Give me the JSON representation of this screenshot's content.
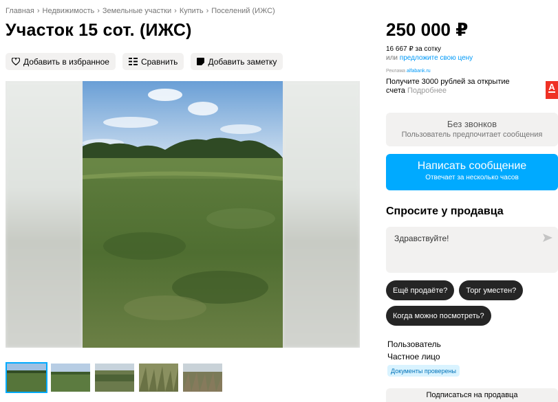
{
  "breadcrumb": [
    "Главная",
    "Недвижимость",
    "Земельные участки",
    "Купить",
    "Поселений (ИЖС)"
  ],
  "breadcrumb_sep": "›",
  "title": "Участок 15 сот. (ИЖС)",
  "actions": {
    "favorite": "Добавить в избранное",
    "compare": "Сравнить",
    "note": "Добавить заметку"
  },
  "gallery": {
    "thumb_count": 5,
    "active_thumb": 1
  },
  "price": "250 000 ₽",
  "price_per_sotka": "16 667 ₽ за сотку",
  "offer_prefix": "или",
  "offer_link": "предложите свою цену",
  "ad": {
    "label": "Реклама",
    "source": "alfabank.ru",
    "text": "Получите 3000 рублей за открытие счета",
    "more": "Подробнее",
    "logo_letter": "А"
  },
  "contact": {
    "no_calls_title": "Без звонков",
    "no_calls_sub": "Пользователь предпочитает сообщения",
    "write_button": "Написать сообщение",
    "write_sub": "Отвечает за несколько часов"
  },
  "ask": {
    "title": "Спросите у продавца",
    "input_value": "Здравствуйте!",
    "chips": [
      "Ещё продаёте?",
      "Торг уместен?",
      "Когда можно посмотреть?"
    ]
  },
  "seller": {
    "name": "Пользователь",
    "type": "Частное лицо",
    "docs_badge": "Документы проверены",
    "subscribe": "Подписаться на продавца"
  },
  "colors": {
    "accent": "#00aaff",
    "link": "#0099f7",
    "chip_bg": "#252525",
    "button_bg": "#f2f1f0"
  }
}
